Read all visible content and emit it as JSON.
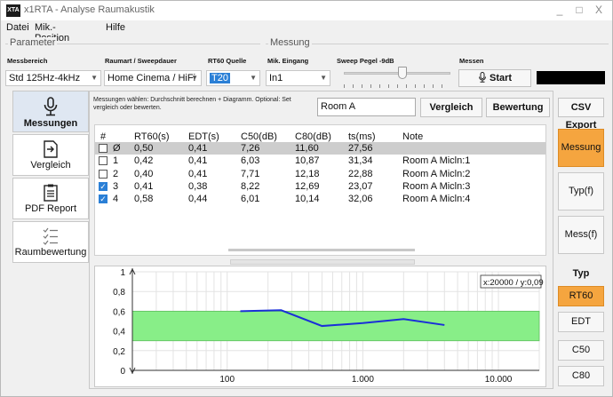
{
  "window": {
    "icon_text": "XTA",
    "title": "x1RTA - Analyse Raumakustik",
    "minimize": "_",
    "maximize": "□",
    "close": "X"
  },
  "menu": [
    "Datei",
    "Mik.-Position",
    "Hilfe"
  ],
  "parameter_group": {
    "label": "Parameter",
    "messbereich_label": "Messbereich",
    "messbereich_value": "Std 125Hz-4kHz",
    "raumart_label": "Raumart / Sweepdauer",
    "raumart_value": "Home Cinema / HiFi",
    "rt60_label": "RT60 Quelle",
    "rt60_value": "T20"
  },
  "messung_group": {
    "label": "Messung",
    "mik_label": "Mik. Eingang",
    "mik_value": "In1",
    "sweep_label": "Sweep Pegel -9dB",
    "sweep_level": 0.55,
    "messen_label": "Messen",
    "start_label": "Start"
  },
  "tabs": [
    {
      "label": "Messungen",
      "icon": "microphone-icon",
      "active": true
    },
    {
      "label": "Vergleich",
      "icon": "compare-document-icon",
      "active": false
    },
    {
      "label": "PDF Report",
      "icon": "report-document-icon",
      "active": false
    },
    {
      "label": "Raumbewertung",
      "icon": "checklist-icon",
      "active": false
    }
  ],
  "hint": "Messungen wählen: Durchschnitt berechnen + Diagramm. Optional: Set vergleich oder bewerten.",
  "name_input": "Room A",
  "buttons": {
    "vergleich": "Vergleich",
    "bewertung": "Bewertung",
    "csv_export": "CSV Export"
  },
  "table": {
    "headers": [
      "#",
      "RT60(s)",
      "EDT(s)",
      "C50(dB)",
      "C80(dB)",
      "ts(ms)",
      "Note"
    ],
    "rows": [
      {
        "id": "Ø",
        "checked": false,
        "selected": true,
        "rt60": "0,50",
        "edt": "0,41",
        "c50": "7,26",
        "c80": "11,60",
        "ts": "27,56",
        "note": ""
      },
      {
        "id": "1",
        "checked": false,
        "selected": false,
        "rt60": "0,42",
        "edt": "0,41",
        "c50": "6,03",
        "c80": "10,87",
        "ts": "31,34",
        "note": "Room A Micln:1"
      },
      {
        "id": "2",
        "checked": false,
        "selected": false,
        "rt60": "0,40",
        "edt": "0,41",
        "c50": "7,71",
        "c80": "12,18",
        "ts": "22,88",
        "note": "Room A Micln:2"
      },
      {
        "id": "3",
        "checked": true,
        "selected": false,
        "rt60": "0,41",
        "edt": "0,38",
        "c50": "8,22",
        "c80": "12,69",
        "ts": "23,07",
        "note": "Room A Micln:3"
      },
      {
        "id": "4",
        "checked": true,
        "selected": false,
        "rt60": "0,58",
        "edt": "0,44",
        "c50": "6,01",
        "c80": "10,14",
        "ts": "32,06",
        "note": "Room A Micln:4"
      }
    ]
  },
  "right_panel": {
    "messung": "Messung",
    "typ_f": "Typ(f)",
    "mess_f": "Mess(f)",
    "typ_label": "Typ",
    "types": [
      "RT60",
      "EDT",
      "C50",
      "C80"
    ],
    "active_type": "RT60"
  },
  "colors": {
    "accent_orange": "#f5a53f",
    "band_green": "#88ee88",
    "line_blue": "#1a2fd8",
    "highlight_blue": "#2a7fd6"
  },
  "chart_data": {
    "type": "line",
    "xscale": "log",
    "xlim": [
      20,
      20000
    ],
    "ylim": [
      0,
      1
    ],
    "x_ticks": [
      100,
      1000,
      10000
    ],
    "x_tick_labels": [
      "100",
      "1.000",
      "10.000"
    ],
    "y_ticks": [
      0,
      0.2,
      0.4,
      0.6,
      0.8,
      1
    ],
    "y_tick_labels": [
      "0",
      "0,2",
      "0,4",
      "0,6",
      "0,8",
      "1"
    ],
    "target_band": [
      0.3,
      0.6
    ],
    "readout": "x:20000 / y:0,09",
    "grid": true,
    "series": [
      {
        "x": [
          125,
          250,
          500,
          1000,
          2000,
          4000
        ],
        "y": [
          0.6,
          0.61,
          0.45,
          0.48,
          0.52,
          0.46
        ]
      }
    ]
  }
}
